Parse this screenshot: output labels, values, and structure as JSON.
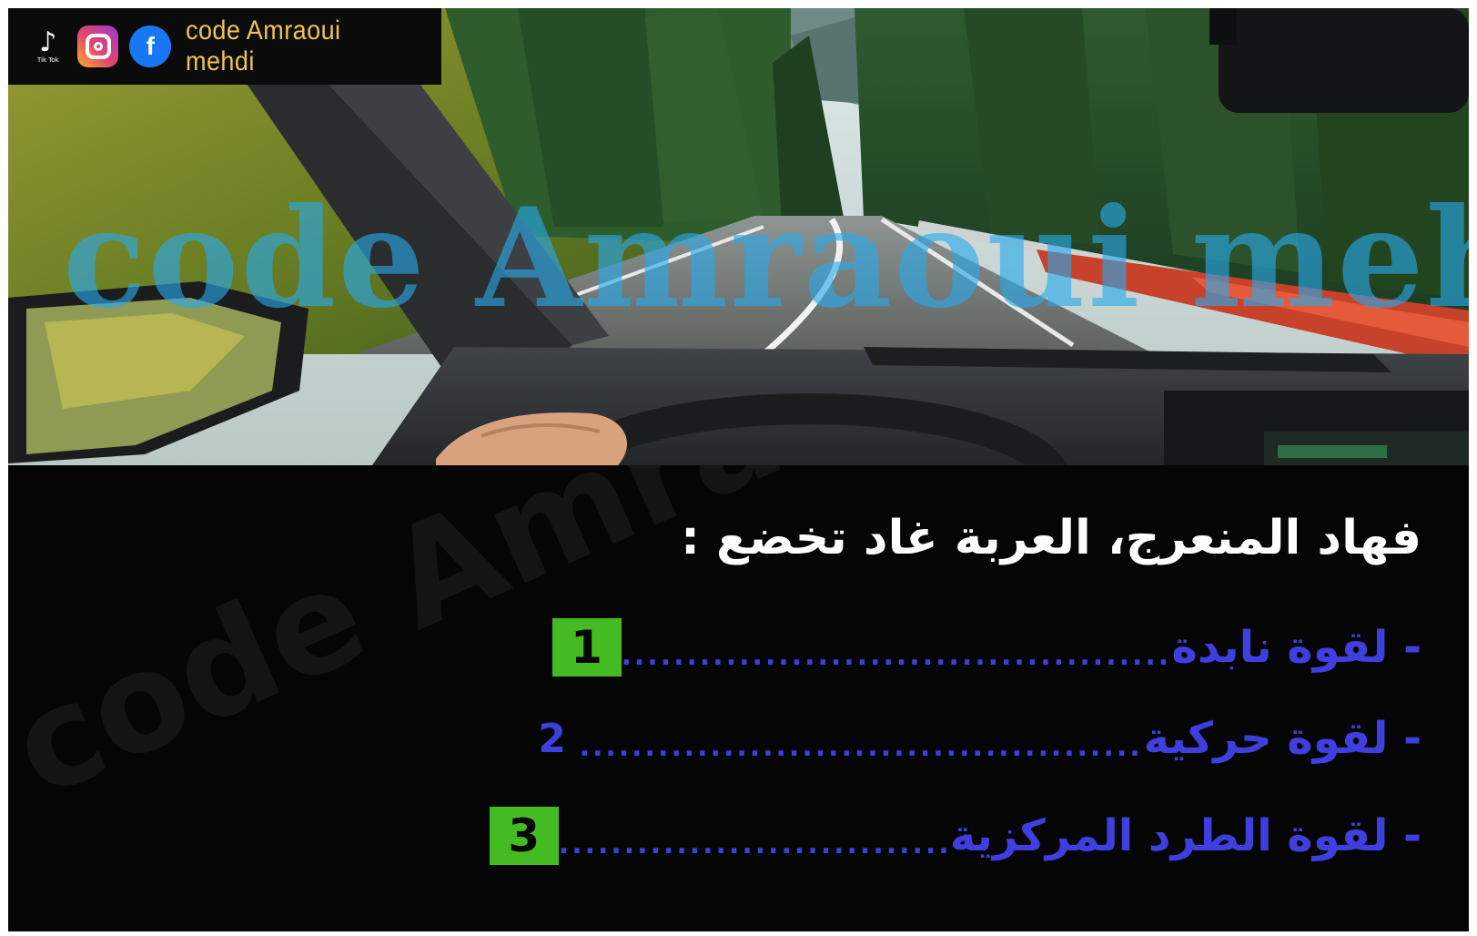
{
  "social": {
    "tiktok_label": "Tik Tok",
    "channel_name": "code Amraoui mehdi",
    "icons": [
      "tiktok-icon",
      "instagram-icon",
      "facebook-icon"
    ]
  },
  "scene": {
    "watermark": "code Amraoui mehdi"
  },
  "question": {
    "title": "فهاد المنعرج، العربة غاد تخضع :",
    "answers": [
      {
        "text": "- لقوة نابدة",
        "number": "1",
        "highlighted": true
      },
      {
        "text": "- لقوة حركية",
        "number": "2",
        "highlighted": false
      },
      {
        "text": "- لقوة الطرد المركزية",
        "number": "3",
        "highlighted": true
      }
    ]
  },
  "panel": {
    "watermark": "code Amraoui mehdi"
  },
  "colors": {
    "answer_text": "#3f3fe0",
    "badge_bg": "#44bb22",
    "channel_text": "#f0c64a",
    "panel_bg": "#050505"
  }
}
